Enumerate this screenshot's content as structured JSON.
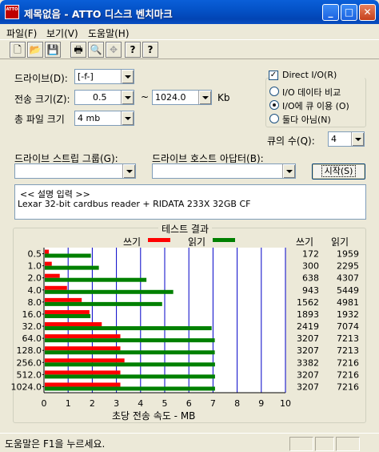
{
  "window": {
    "app_icon_text": "ATTO",
    "title": "제목없음 - ATTO 디스크 벤치마크",
    "minimize": "_",
    "maximize": "□",
    "close": "✕"
  },
  "menu": [
    "파일(F)",
    "보기(V)",
    "도움말(H)"
  ],
  "toolbar": {
    "icons": [
      "new-document-icon",
      "open-folder-icon",
      "save-disk-icon",
      "print-icon",
      "print-preview-icon",
      "move-icon",
      "help-icon",
      "context-help-icon"
    ],
    "glyphs": [
      "🗋",
      "📂",
      "💾",
      "🖶",
      "🔍",
      "✥",
      "?",
      "?"
    ]
  },
  "form": {
    "drive_label": "드라이브(D):",
    "drive_value": "[-f-]",
    "transfer_label": "전송 크기(Z):",
    "transfer_min": "0.5",
    "tilde": "~",
    "transfer_max": "1024.0",
    "transfer_unit": "Kb",
    "total_label": "총 파일 크기",
    "total_value": "4 mb",
    "direct_io_label": "Direct I/O(R)",
    "direct_io_checked": true,
    "radio_compare": "I/O 데이타 비교",
    "radio_overlap": "I/O에 큐 이용 (O)",
    "radio_none": "둘다 아님(N)",
    "queue_label": "큐의 수(Q):",
    "queue_value": "4",
    "stream_group_label": "드라이브 스트립 그룹(G):",
    "host_adapter_label": "드라이브 호스트 아답터(B):",
    "start_button": "시작(S)",
    "description_line1": "<< 설명 입력 >>",
    "description_line2": "Lexar 32-bit cardbus reader + RIDATA 233X 32GB CF"
  },
  "results": {
    "title": "테스트 결과",
    "write_legend": "쓰기",
    "read_legend": "읽기",
    "write_col_header": "쓰기",
    "read_col_header": "읽기",
    "xlabel": "초당 전송 속도 - MB",
    "write_color": "#ff0000",
    "read_color": "#008000"
  },
  "chart_data": {
    "type": "bar",
    "orientation": "horizontal",
    "title": "테스트 결과",
    "xlabel": "초당 전송 속도 - MB",
    "xlim": [
      0,
      10
    ],
    "xticks": [
      "0",
      "1",
      "2",
      "3",
      "4",
      "5",
      "6",
      "7",
      "8",
      "9",
      "10"
    ],
    "categories": [
      "0.5",
      "1.0",
      "2.0",
      "4.0",
      "8.0",
      "16.0",
      "32.0",
      "64.0",
      "128.0",
      "256.0",
      "512.0",
      "1024.0"
    ],
    "series": [
      {
        "name": "쓰기",
        "color": "#ff0000",
        "values": [
          0.17,
          0.29,
          0.62,
          0.92,
          1.53,
          1.85,
          2.36,
          3.13,
          3.13,
          3.3,
          3.13,
          3.13
        ]
      },
      {
        "name": "읽기",
        "color": "#008000",
        "values": [
          1.91,
          2.24,
          4.21,
          5.32,
          4.86,
          1.89,
          6.91,
          7.04,
          7.04,
          7.05,
          7.05,
          7.05
        ]
      }
    ],
    "write_kb": [
      "172",
      "300",
      "638",
      "943",
      "1562",
      "1893",
      "2419",
      "3207",
      "3207",
      "3382",
      "3207",
      "3207"
    ],
    "read_kb": [
      "1959",
      "2295",
      "4307",
      "5449",
      "4981",
      "1932",
      "7074",
      "7213",
      "7213",
      "7216",
      "7216",
      "7216"
    ],
    "grid": true,
    "legend": "top"
  },
  "status": {
    "text": "도움말은 F1을 누르세요."
  }
}
